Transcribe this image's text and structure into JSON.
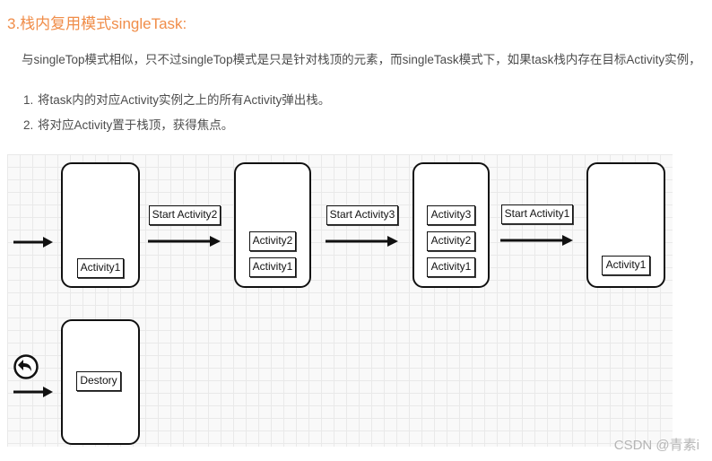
{
  "heading": "3.栈内复用模式singleTask:",
  "paragraph": "与singleTop模式相似，只不过singleTop模式是只是针对栈顶的元素，而singleTask模式下，如果task栈内存在目标Activity实例，",
  "steps": [
    {
      "num": "1.",
      "text": "将task内的对应Activity实例之上的所有Activity弹出栈。"
    },
    {
      "num": "2.",
      "text": "将对应Activity置于栈顶，获得焦点。"
    }
  ],
  "diagram": {
    "transitions": [
      "Start Activity2",
      "Start Activity3",
      "Start Activity1"
    ],
    "stack1": [
      "Activity1"
    ],
    "stack2": [
      "Activity2",
      "Activity1"
    ],
    "stack3": [
      "Activity3",
      "Activity2",
      "Activity1"
    ],
    "stack4": [
      "Activity1"
    ],
    "stack5": [
      "Destory"
    ]
  },
  "watermark": "CSDN @青素i"
}
